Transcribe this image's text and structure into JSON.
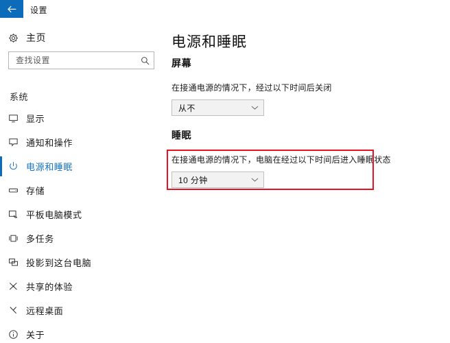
{
  "titlebar": {
    "app_title": "设置",
    "back_icon": "arrow-left-icon",
    "accent_color": "#0d6cb9"
  },
  "sidebar": {
    "home": {
      "label": "主页",
      "icon": "gear-icon"
    },
    "search": {
      "placeholder": "查找设置",
      "value": "",
      "icon": "search-icon"
    },
    "group_header": "系统",
    "items": [
      {
        "label": "显示",
        "icon": "monitor-icon",
        "selected": false
      },
      {
        "label": "通知和操作",
        "icon": "notification-icon",
        "selected": false
      },
      {
        "label": "电源和睡眠",
        "icon": "power-icon",
        "selected": true
      },
      {
        "label": "存储",
        "icon": "storage-icon",
        "selected": false
      },
      {
        "label": "平板电脑模式",
        "icon": "tablet-mode-icon",
        "selected": false
      },
      {
        "label": "多任务",
        "icon": "multitasking-icon",
        "selected": false
      },
      {
        "label": "投影到这台电脑",
        "icon": "project-icon",
        "selected": false
      },
      {
        "label": "共享的体验",
        "icon": "shared-experience-icon",
        "selected": false
      },
      {
        "label": "远程桌面",
        "icon": "remote-desktop-icon",
        "selected": false
      },
      {
        "label": "关于",
        "icon": "info-icon",
        "selected": false
      }
    ],
    "selected_accent_color": "#0d6cb9"
  },
  "main": {
    "page_title": "电源和睡眠",
    "sections": [
      {
        "title": "屏幕",
        "description": "在接通电源的情况下，经过以下时间后关闭",
        "dropdown": {
          "value": "从不",
          "icon": "chevron-down-icon"
        }
      },
      {
        "title": "睡眠",
        "description": "在接通电源的情况下，电脑在经过以下时间后进入睡眠状态",
        "dropdown": {
          "value": "10 分钟",
          "icon": "chevron-down-icon"
        }
      }
    ]
  },
  "annotation": {
    "color": "#e81123",
    "name": "sleep-setting-highlight"
  }
}
